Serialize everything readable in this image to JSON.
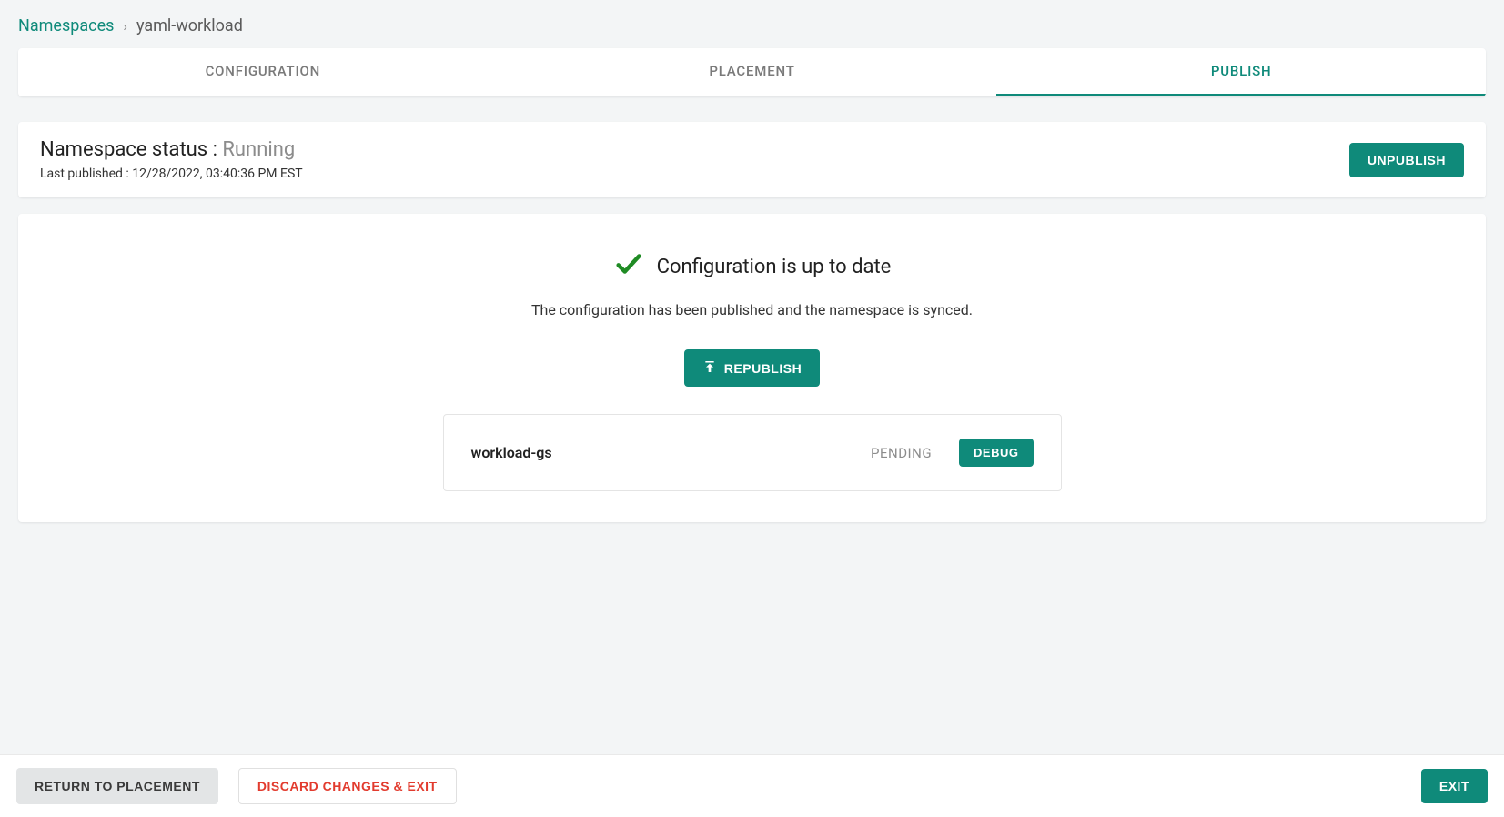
{
  "breadcrumb": {
    "root": "Namespaces",
    "separator": "›",
    "current": "yaml-workload"
  },
  "tabs": [
    {
      "label": "CONFIGURATION",
      "active": false
    },
    {
      "label": "PLACEMENT",
      "active": false
    },
    {
      "label": "PUBLISH",
      "active": true
    }
  ],
  "status": {
    "label": "Namespace status : ",
    "value": "Running",
    "last_published_label": "Last published : ",
    "last_published_value": "12/28/2022, 03:40:36 PM EST",
    "unpublish": "UNPUBLISH"
  },
  "main": {
    "heading": "Configuration is up to date",
    "description": "The configuration has been published and the namespace is synced.",
    "republish": "REPUBLISH",
    "items": [
      {
        "name": "workload-gs",
        "status": "PENDING",
        "debug": "DEBUG"
      }
    ]
  },
  "footer": {
    "return": "RETURN TO PLACEMENT",
    "discard": "DISCARD CHANGES & EXIT",
    "exit": "EXIT"
  },
  "colors": {
    "teal": "#0f8a7a",
    "green_check": "#1f8b24",
    "red": "#e23b2e"
  }
}
